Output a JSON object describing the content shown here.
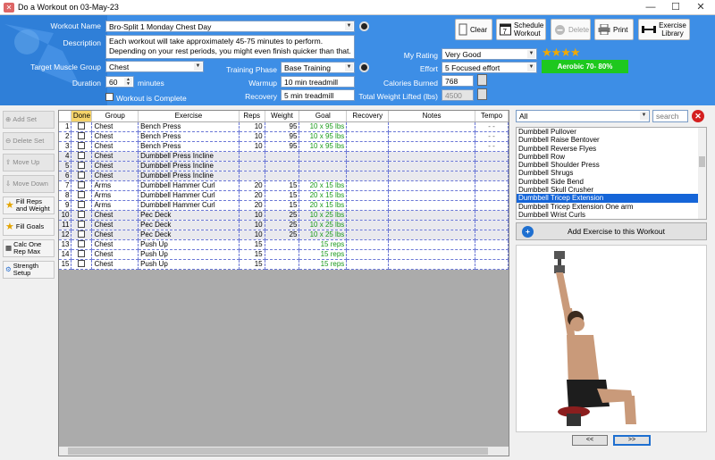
{
  "window": {
    "title": "Do a Workout on 03-May-23",
    "app_icon": "dumbbell-app-icon"
  },
  "form": {
    "workout_name_label": "Workout Name",
    "workout_name": "Bro-Split 1 Monday Chest Day",
    "description_label": "Description",
    "description": "Each workout will take approximately 45-75 minutes to perform. Depending on your rest periods, you might even finish quicker than that.  Try to increase the",
    "target_label": "Target Muscle Group",
    "target": "Chest",
    "duration_label": "Duration",
    "duration": "60",
    "duration_unit": "minutes",
    "complete_label": "Workout is Complete",
    "phase_label": "Training Phase",
    "phase": "Base Training",
    "warmup_label": "Warmup",
    "warmup": "10 min treadmill",
    "recovery_label": "Recovery",
    "recovery": "5 min treadmill",
    "rating_label": "My Rating",
    "rating": "Very Good",
    "stars": 4,
    "effort_label": "Effort",
    "effort": "5 Focused effort",
    "zone": "Aerobic 70- 80%",
    "zone_color": "#1ec81e",
    "calories_label": "Calories Burned",
    "calories": "768",
    "weight_label": "Total Weight Lifted (lbs)",
    "weight": "4500"
  },
  "toolbar": {
    "clear": "Clear",
    "schedule": "Schedule Workout",
    "schedule_day": "7",
    "delete": "Delete",
    "print": "Print",
    "library": "Exercise Library"
  },
  "leftbar": {
    "add_set": "Add Set",
    "delete_set": "Delete Set",
    "move_up": "Move Up",
    "move_down": "Move Down",
    "fill_reps": "Fill Reps and Weight",
    "fill_goals": "Fill Goals",
    "calc": "Calc One Rep Max",
    "strength": "Strength Setup"
  },
  "table": {
    "headers": [
      "",
      "Done",
      "Group",
      "Exercise",
      "Reps",
      "Weight",
      "Goal",
      "Recovery",
      "Notes",
      "Tempo"
    ],
    "rows": [
      [
        "1",
        "",
        "Chest",
        "Bench Press",
        "10",
        "95",
        "10 x 95 lbs",
        "",
        "",
        "- -"
      ],
      [
        "2",
        "",
        "Chest",
        "Bench Press",
        "10",
        "95",
        "10 x 95 lbs",
        "",
        "",
        "- -"
      ],
      [
        "3",
        "",
        "Chest",
        "Bench Press",
        "10",
        "95",
        "10 x 95 lbs",
        "",
        "",
        "- -"
      ],
      [
        "4",
        "",
        "Chest",
        "Dumbbell Press Incline",
        "",
        "",
        "",
        "",
        "",
        ""
      ],
      [
        "5",
        "",
        "Chest",
        "Dumbbell Press Incline",
        "",
        "",
        "",
        "",
        "",
        ""
      ],
      [
        "6",
        "",
        "Chest",
        "Dumbbell Press Incline",
        "",
        "",
        "",
        "",
        "",
        ""
      ],
      [
        "7",
        "",
        "Arms",
        "Dumbbell Hammer Curl",
        "20",
        "15",
        "20 x 15 lbs",
        "",
        "",
        ""
      ],
      [
        "8",
        "",
        "Arms",
        "Dumbbell Hammer Curl",
        "20",
        "15",
        "20 x 15 lbs",
        "",
        "",
        ""
      ],
      [
        "9",
        "",
        "Arms",
        "Dumbbell Hammer Curl",
        "20",
        "15",
        "20 x 15 lbs",
        "",
        "",
        ""
      ],
      [
        "10",
        "",
        "Chest",
        "Pec Deck",
        "10",
        "25",
        "10 x 25 lbs",
        "",
        "",
        ""
      ],
      [
        "11",
        "",
        "Chest",
        "Pec Deck",
        "10",
        "25",
        "10 x 25 lbs",
        "",
        "",
        ""
      ],
      [
        "12",
        "",
        "Chest",
        "Pec Deck",
        "10",
        "25",
        "10 x 25 lbs",
        "",
        "",
        ""
      ],
      [
        "13",
        "",
        "Chest",
        "Push Up",
        "15",
        "",
        "15 reps",
        "",
        "",
        ""
      ],
      [
        "14",
        "",
        "Chest",
        "Push Up",
        "15",
        "",
        "15 reps",
        "",
        "",
        ""
      ],
      [
        "15",
        "",
        "Chest",
        "Push Up",
        "15",
        "",
        "15 reps",
        "",
        "",
        ""
      ]
    ]
  },
  "library": {
    "filter": "All",
    "search_placeholder": "search",
    "items": [
      "Dumbbell Pullover",
      "Dumbbell Raise Bentover",
      "Dumbbell Reverse Flyes",
      "Dumbbell Row",
      "Dumbbell Shoulder Press",
      "Dumbbell Shrugs",
      "Dumbbell Side Bend",
      "Dumbbell Skull Crusher",
      "Dumbbell Tricep Extension",
      "Dumbbell Tricep Extension One arm",
      "Dumbbell Wrist Curls"
    ],
    "selected": "Dumbbell Tricep Extension",
    "add_button": "Add Exercise to this Workout",
    "prev": "<<",
    "next": ">>"
  }
}
